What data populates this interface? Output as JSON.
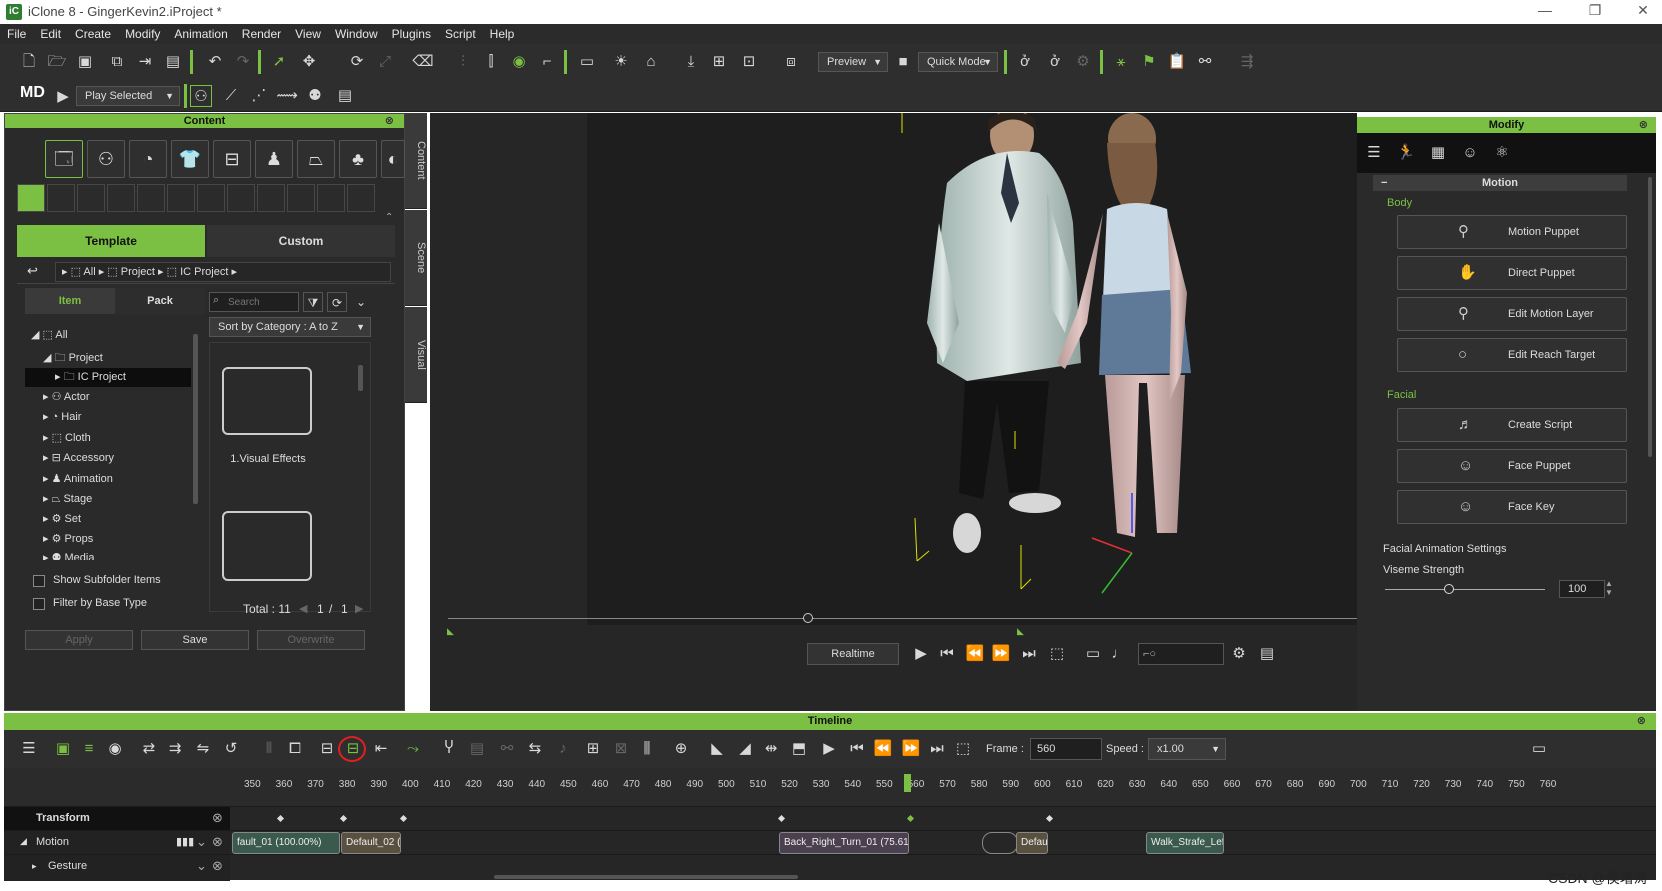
{
  "window": {
    "title": "iClone 8 - GingerKevin2.iProject *",
    "min": "—",
    "max": "❐",
    "close": "✕"
  },
  "menu": [
    "File",
    "Edit",
    "Create",
    "Modify",
    "Animation",
    "Render",
    "View",
    "Window",
    "Plugins",
    "Script",
    "Help"
  ],
  "toolbar": {
    "preview": "Preview",
    "quick_mode": "Quick Mode",
    "play_selected": "Play Selected",
    "md_logo": "MD"
  },
  "content": {
    "title": "Content",
    "tabs": {
      "template": "Template",
      "custom": "Custom"
    },
    "breadcrumb": [
      "All",
      "Project",
      "IC Project"
    ],
    "subtabs": {
      "item": "Item",
      "pack": "Pack"
    },
    "search_placeholder": "Search",
    "sort": "Sort by Category : A to Z",
    "tree": [
      "All",
      "Project",
      "IC Project",
      "Actor",
      "Hair",
      "Cloth",
      "Accessory",
      "Animation",
      "Stage",
      "Set",
      "Props",
      "Media"
    ],
    "thumbs": [
      "1.Visual Effects"
    ],
    "show_subfolder": "Show Subfolder Items",
    "filter_base": "Filter by Base Type",
    "total": "Total : 11",
    "page": "1",
    "slash": "/",
    "pages": "1",
    "apply": "Apply",
    "save": "Save",
    "overwrite": "Overwrite"
  },
  "side_tabs": [
    "Content",
    "Scene",
    "Visual"
  ],
  "playback": {
    "realtime": "Realtime"
  },
  "modify": {
    "title": "Modify",
    "section": "Motion",
    "body_group": "Body",
    "body_buttons": [
      "Motion Puppet",
      "Direct Puppet",
      "Edit Motion Layer",
      "Edit Reach Target"
    ],
    "facial_group": "Facial",
    "facial_buttons": [
      "Create Script",
      "Face Puppet",
      "Face Key"
    ],
    "facial_settings": "Facial Animation Settings",
    "viseme_label": "Viseme Strength",
    "viseme_value": "100",
    "viseme_fraction": 0.4
  },
  "timeline": {
    "title": "Timeline",
    "frame_label": "Frame :",
    "frame_value": "560",
    "speed_label": "Speed :",
    "speed_value": "x1.00",
    "ticks": [
      "350",
      "360",
      "370",
      "380",
      "390",
      "400",
      "410",
      "420",
      "430",
      "440",
      "450",
      "460",
      "470",
      "480",
      "490",
      "500",
      "510",
      "520",
      "530",
      "540",
      "550",
      "560",
      "570",
      "580",
      "590",
      "600",
      "610",
      "620",
      "630",
      "640",
      "650",
      "660",
      "670",
      "680",
      "690",
      "700",
      "710",
      "720",
      "730",
      "740",
      "750",
      "760"
    ],
    "tracks": {
      "transform": "Transform",
      "motion": "Motion",
      "gesture": "Gesture"
    },
    "clips": [
      "fault_01 (100.00%)",
      "Default_02 (",
      "Back_Right_Turn_01 (75.61",
      "Defau",
      "Walk_Strafe_Left"
    ]
  },
  "watermark": "CSDN @侯增涛",
  "colors": {
    "accent": "#7bc043",
    "panel": "#2a2a2a",
    "highlight": "#e02020"
  }
}
